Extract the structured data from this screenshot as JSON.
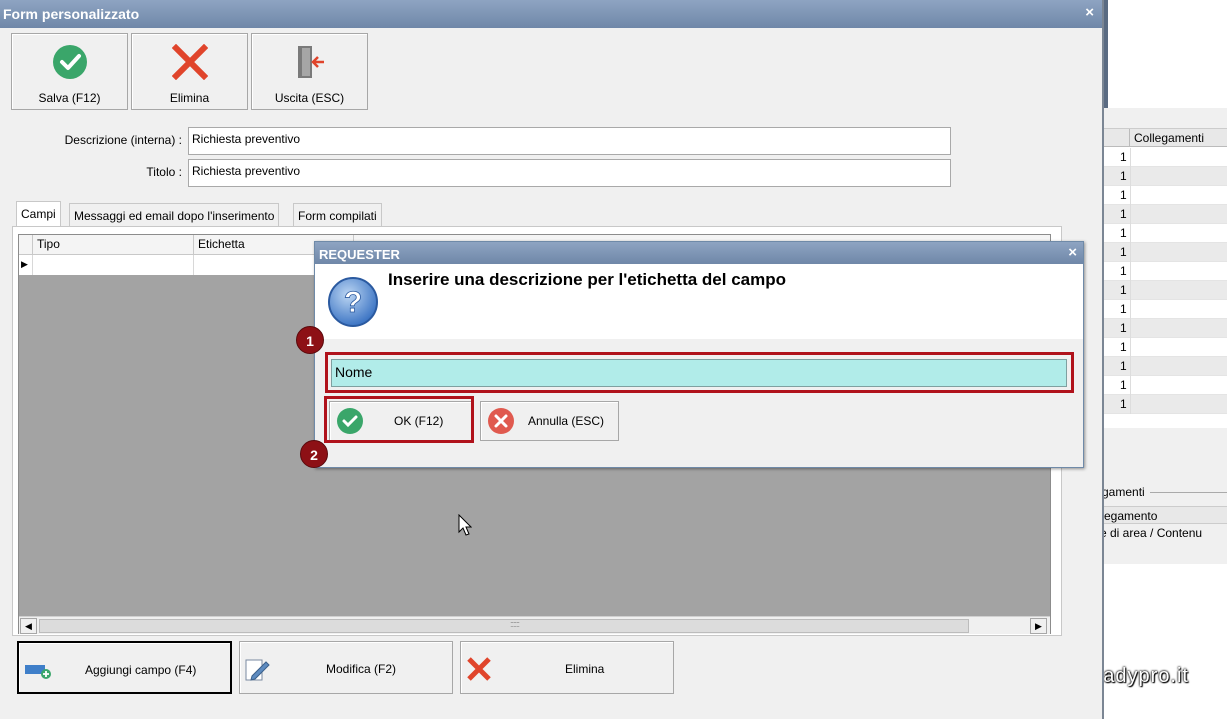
{
  "window": {
    "title": "Form personalizzato",
    "close_glyph": "×"
  },
  "toolbar": [
    {
      "label": "Salva (F12)",
      "icon": "check-circle-icon"
    },
    {
      "label": "Elimina",
      "icon": "red-x-icon"
    },
    {
      "label": "Uscita (ESC)",
      "icon": "exit-door-icon"
    }
  ],
  "fields": {
    "descrizione": {
      "label": "Descrizione (interna) :",
      "value": "Richiesta preventivo"
    },
    "titolo": {
      "label": "Titolo :",
      "value": "Richiesta preventivo"
    }
  },
  "tabs": [
    {
      "label": "Campi",
      "active": true
    },
    {
      "label": "Messaggi ed email dopo l'inserimento",
      "active": false
    },
    {
      "label": "Form compilati",
      "active": false
    }
  ],
  "grid": {
    "columns": [
      "Tipo",
      "Etichetta"
    ],
    "row_indicator": "▶"
  },
  "scrollbar": {
    "left": "◀",
    "right": "▶",
    "grip": "::::::"
  },
  "bottom_buttons": [
    {
      "label": "Aggiungi campo (F4)",
      "icon": "add-field-icon"
    },
    {
      "label": "Modifica (F2)",
      "icon": "edit-pencil-icon"
    },
    {
      "label": "Elimina",
      "icon": "red-x-icon"
    }
  ],
  "dialog": {
    "title": "REQUESTER",
    "close_glyph": "×",
    "message": "Inserire una descrizione per l'etichetta del campo",
    "input_value": "Nome",
    "ok_label": "OK (F12)",
    "cancel_label": "Annulla (ESC)"
  },
  "annotations": [
    "1",
    "2"
  ],
  "background_app": {
    "grid_header": "Collegamenti",
    "row_values": [
      "1",
      "1",
      "1",
      "1",
      "1",
      "1",
      "1",
      "1",
      "1",
      "1",
      "1",
      "1",
      "1",
      "1"
    ],
    "group_legend": "gamenti",
    "group_header": "ollegamento",
    "group_row": "me di area / Contenu"
  },
  "watermark": "readypro.it",
  "colors": {
    "accent_red": "#b0121b",
    "badge": "#8d1015",
    "input_bg": "#b1ece9",
    "titlebar": "#7f97b8"
  }
}
